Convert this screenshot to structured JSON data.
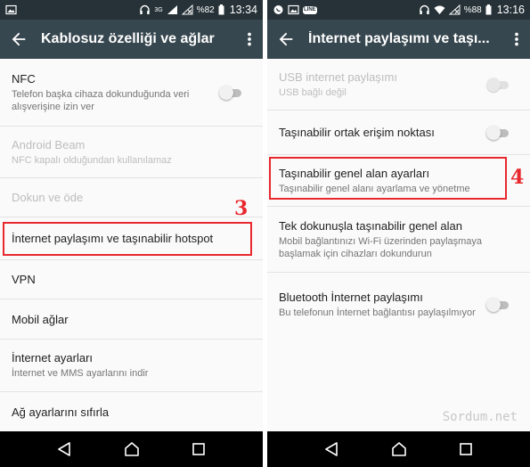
{
  "left": {
    "status": {
      "battery_pct": "%82",
      "time": "13:34",
      "network": "3G"
    },
    "appbar": {
      "title": "Kablosuz özelliği ve ağlar"
    },
    "items": [
      {
        "title": "NFC",
        "subtitle": "Telefon başka cihaza dokunduğunda veri alışverişine izin ver"
      },
      {
        "title": "Android Beam",
        "subtitle": "NFC kapalı olduğundan kullanılamaz"
      },
      {
        "title": "Dokun ve öde"
      },
      {
        "title": "İnternet paylaşımı ve taşınabilir hotspot"
      },
      {
        "title": "VPN"
      },
      {
        "title": "Mobil ağlar"
      },
      {
        "title": "İnternet ayarları",
        "subtitle": "İnternet ve MMS ayarlarını indir"
      },
      {
        "title": "Ağ ayarlarını sıfırla"
      }
    ],
    "step": "3"
  },
  "right": {
    "status": {
      "battery_pct": "%88",
      "time": "13:16",
      "app_badge": "LINE"
    },
    "appbar": {
      "title": "İnternet paylaşımı ve taşı..."
    },
    "items": [
      {
        "title": "USB internet paylaşımı",
        "subtitle": "USB bağlı değil"
      },
      {
        "title": "Taşınabilir ortak erişim noktası"
      },
      {
        "title": "Taşınabilir genel alan ayarları",
        "subtitle": "Taşınabilir genel alanı ayarlama ve yönetme"
      },
      {
        "title": "Tek dokunuşla taşınabilir genel alan",
        "subtitle": "Mobil bağlantınızı Wi-Fi üzerinden paylaşmaya başlamak için cihazları dokundurun"
      },
      {
        "title": "Bluetooth İnternet paylaşımı",
        "subtitle": "Bu telefonun İnternet bağlantısı paylaşılmıyor"
      }
    ],
    "step": "4"
  },
  "watermark": "Sordum.net",
  "colors": {
    "statusbar": "#263238",
    "appbar": "#37474f",
    "highlight": "#e8282e",
    "navbar": "#000000"
  }
}
